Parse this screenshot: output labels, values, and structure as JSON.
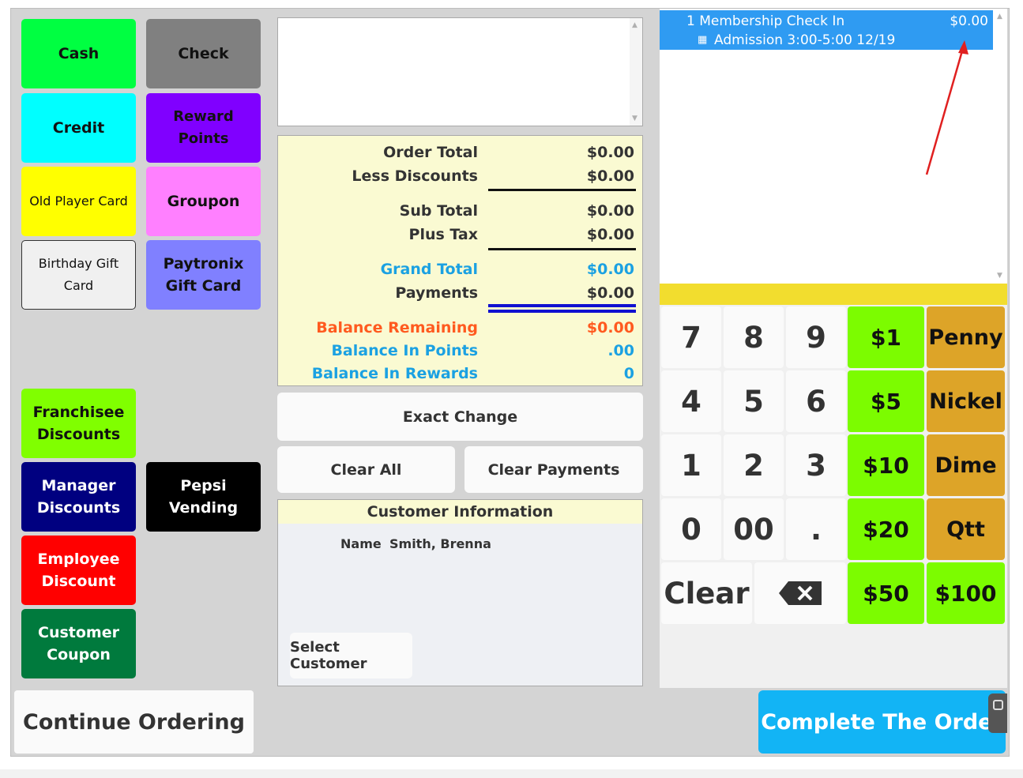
{
  "payments": {
    "cash": "Cash",
    "check": "Check",
    "credit": "Credit",
    "reward_points": "Reward Points",
    "old_player_card": "Old Player Card",
    "groupon": "Groupon",
    "birthday_gift_card": "Birthday Gift Card",
    "paytronix_gift_card": "Paytronix Gift Card",
    "franchisee_discounts": "Franchisee Discounts",
    "manager_discounts": "Manager Discounts",
    "pepsi_vending": "Pepsi Vending",
    "employee_discount": "Employee Discount",
    "customer_coupon": "Customer Coupon"
  },
  "totals": {
    "order_total_label": "Order Total",
    "order_total": "$0.00",
    "less_discounts_label": "Less Discounts",
    "less_discounts": "$0.00",
    "sub_total_label": "Sub Total",
    "sub_total": "$0.00",
    "plus_tax_label": "Plus Tax",
    "plus_tax": "$0.00",
    "grand_total_label": "Grand Total",
    "grand_total": "$0.00",
    "payments_label": "Payments",
    "payments": "$0.00",
    "balance_remaining_label": "Balance Remaining",
    "balance_remaining": "$0.00",
    "balance_points_label": "Balance In Points",
    "balance_points": ".00",
    "balance_rewards_label": "Balance In Rewards",
    "balance_rewards": "0"
  },
  "actions": {
    "exact_change": "Exact Change",
    "clear_all": "Clear All",
    "clear_payments": "Clear Payments",
    "continue_ordering": "Continue Ordering",
    "complete_order": "Complete The Order"
  },
  "customer": {
    "header": "Customer Information",
    "name_label": "Name",
    "name_value": "Smith, Brenna",
    "select_button": "Select Customer"
  },
  "order": {
    "item_line": "1 Membership Check In",
    "item_price": "$0.00",
    "sub_line": "Admission 3:00-5:00 12/19"
  },
  "keypad": {
    "k7": "7",
    "k8": "8",
    "k9": "9",
    "k4": "4",
    "k5": "5",
    "k6": "6",
    "k1": "1",
    "k2": "2",
    "k3": "3",
    "k0": "0",
    "k00": "00",
    "kdot": ".",
    "clear": "Clear",
    "m1": "$1",
    "m5": "$5",
    "m10": "$10",
    "m20": "$20",
    "m50": "$50",
    "m100": "$100",
    "penny": "Penny",
    "nickel": "Nickel",
    "dime": "Dime",
    "qtt": "Qtt"
  },
  "colors": {
    "cash": "#00ff41",
    "check": "#808080",
    "credit": "#00ffff",
    "reward_points": "#8000ff",
    "old_player_card": "#ffff00",
    "groupon": "#ff80ff",
    "birthday_gift_card": "#f0f0f0",
    "paytronix_gift_card": "#8080ff",
    "franchisee_discounts": "#80ff00",
    "manager_discounts": "#000080",
    "pepsi_vending": "#000000",
    "employee_discount": "#ff0000",
    "customer_coupon": "#007a3d",
    "grand_total": "#1ba1e2",
    "balance_remaining": "#ff5a1f",
    "order_highlight": "#2f9bf2",
    "complete_button": "#12b4f5",
    "annotation_arrow": "#e02020"
  }
}
